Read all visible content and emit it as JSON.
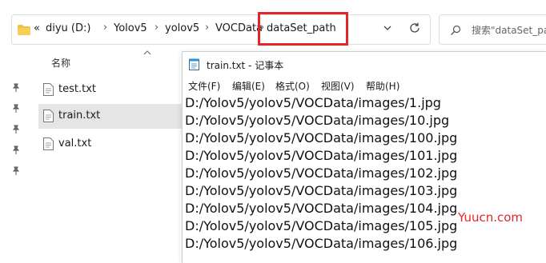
{
  "address_bar": {
    "prefix": "«",
    "crumbs": [
      "diyu (D:)",
      "Yolov5",
      "yolov5",
      "VOCData",
      "dataSet_path"
    ],
    "separator": "›"
  },
  "search": {
    "placeholder": "搜索\"dataSet_path\""
  },
  "file_list": {
    "column_header": "名称",
    "files": [
      {
        "name": "test.txt",
        "selected": false
      },
      {
        "name": "train.txt",
        "selected": true
      },
      {
        "name": "val.txt",
        "selected": false
      }
    ]
  },
  "notepad": {
    "title": "train.txt - 记事本",
    "menu": [
      "文件(F)",
      "编辑(E)",
      "格式(O)",
      "视图(V)",
      "帮助(H)"
    ],
    "lines": [
      "D:/Yolov5/yolov5/VOCData/images/1.jpg",
      "D:/Yolov5/yolov5/VOCData/images/10.jpg",
      "D:/Yolov5/yolov5/VOCData/images/100.jpg",
      "D:/Yolov5/yolov5/VOCData/images/101.jpg",
      "D:/Yolov5/yolov5/VOCData/images/102.jpg",
      "D:/Yolov5/yolov5/VOCData/images/103.jpg",
      "D:/Yolov5/yolov5/VOCData/images/104.jpg",
      "D:/Yolov5/yolov5/VOCData/images/105.jpg",
      "D:/Yolov5/yolov5/VOCData/images/106.jpg"
    ]
  },
  "watermark": "Yuucn.com",
  "colors": {
    "highlight": "#e2262a",
    "selected_row": "#e5e5e5",
    "folder": "#f0c040"
  },
  "icons": [
    "folder-icon",
    "chevron-down-icon",
    "refresh-icon",
    "search-icon",
    "pin-icon",
    "file-icon",
    "notepad-icon"
  ]
}
